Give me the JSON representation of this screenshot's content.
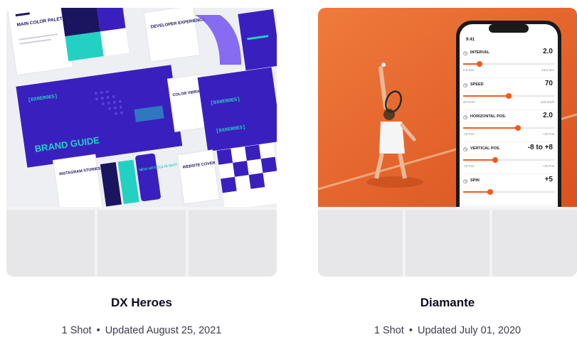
{
  "collections": [
    {
      "title": "DX Heroes",
      "shots": "1 Shot",
      "separator": "•",
      "updated": "Updated August 25, 2021",
      "hero": {
        "brand_mark": "[DXHEROES]",
        "main_heading": "BRAND GUIDE",
        "tile_main_color": "MAIN COLOR PALETTE",
        "tile_colors_gradients": "COLOR VIBRATIONS & GRADIENTS",
        "tile_instagram": "INSTAGRAM STORIES",
        "tile_new_article": "NEW ARTICLE IS OUT!",
        "tile_welcome": "DEVELOPER EXPERIENCE",
        "tile_banner": "WEBSITE COVER",
        "colors": {
          "purple": "#3a1fbf",
          "teal": "#23d1c2",
          "navy": "#1b1560",
          "paper": "#f4f4f7"
        }
      }
    },
    {
      "title": "Diamante",
      "shots": "1 Shot",
      "separator": "•",
      "updated": "Updated July 01, 2020",
      "hero": {
        "time": "9:41",
        "rows": [
          {
            "label": "INTERVAL",
            "value": "2.0",
            "min": "0.5 Sec",
            "max": "10.0 Sec",
            "level": 0.18,
            "icon": "clock-icon"
          },
          {
            "label": "SPEED",
            "value": "70",
            "min": "20 Km/h",
            "max": "120 Km/h",
            "level": 0.5,
            "icon": "speed-icon"
          },
          {
            "label": "HORIZONTAL POS.",
            "value": "2.0",
            "min": "-10 Pos",
            "max": "+10 Pos",
            "level": 0.6,
            "icon": "horizontal-arrows-icon"
          },
          {
            "label": "VERTICAL POS.",
            "value": "-8 to +8",
            "min": "-10 Pos",
            "max": "+10 Pos",
            "level": 0.35,
            "icon": "vertical-arrows-icon"
          },
          {
            "label": "SPIN",
            "value": "+5",
            "min": "",
            "max": "",
            "level": 0.3,
            "icon": "spin-icon"
          }
        ],
        "colors": {
          "clay": "#e8652a",
          "accent": "#f25a1d",
          "phone": "#1a1a1a"
        }
      }
    }
  ]
}
